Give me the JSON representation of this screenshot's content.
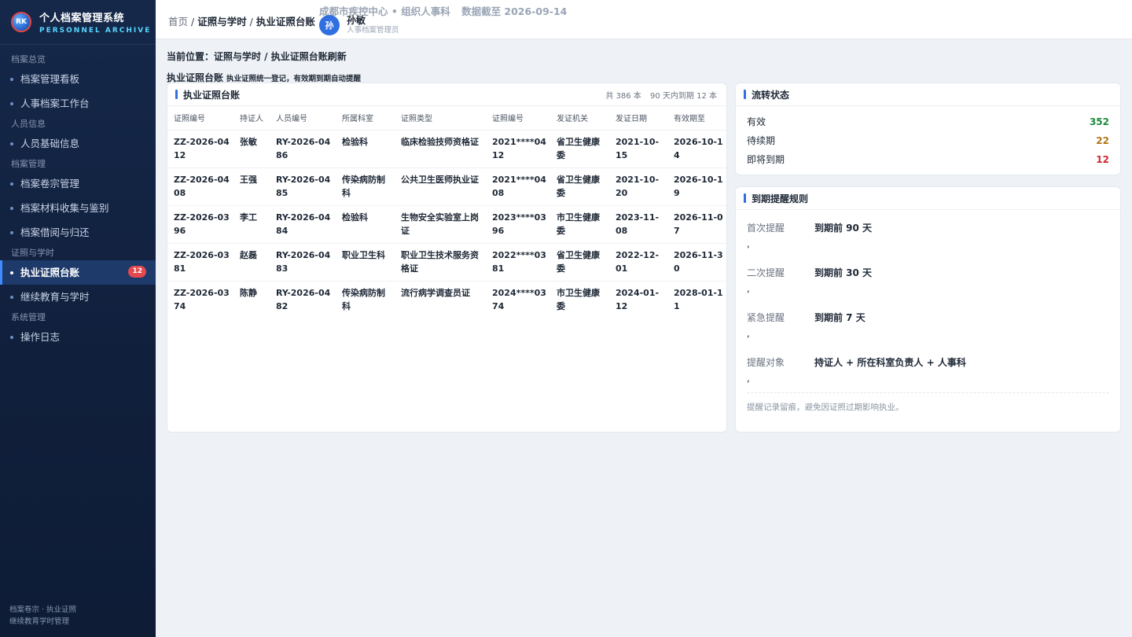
{
  "app": {
    "title": "个人档案管理系统",
    "subtitle": "PERSONNEL ARCHIVE",
    "logo_text": "RK",
    "footer_line1": "档案卷宗 · 执业证照",
    "footer_line2": "继续教育学时管理"
  },
  "sidebar": {
    "groups": [
      {
        "label": "档案总览",
        "items": [
          {
            "label": "档案管理看板"
          },
          {
            "label": "人事档案工作台"
          }
        ]
      },
      {
        "label": "人员信息",
        "items": [
          {
            "label": "人员基础信息"
          }
        ]
      },
      {
        "label": "档案管理",
        "items": [
          {
            "label": "档案卷宗管理"
          },
          {
            "label": "档案材料收集与鉴别"
          },
          {
            "label": "档案借阅与归还"
          }
        ]
      },
      {
        "label": "证照与学时",
        "items": [
          {
            "label": "执业证照台账",
            "badge": "12",
            "active": true
          },
          {
            "label": "继续教育与学时"
          }
        ]
      },
      {
        "label": "系统管理",
        "items": [
          {
            "label": "操作日志"
          }
        ]
      }
    ]
  },
  "topbar": {
    "breadcrumb_home": "首页",
    "breadcrumb_sep1": " / ",
    "breadcrumb_mid": "证照与学时",
    "breadcrumb_sep2": " / ",
    "breadcrumb_current": "执业证照台账",
    "org": "成都市疾控中心 • 组织人事科",
    "data_date": "数据截至 2026-09-14",
    "user_initial": "孙",
    "user_name": "孙敏",
    "user_role": "人事档案管理员"
  },
  "page": {
    "location": "当前位置：证照与学时 / 执业证照台账刷新",
    "title": "执业证照台账",
    "description": "执业证照统一登记，有效期到期自动提醒"
  },
  "ledger": {
    "title": "执业证照台账",
    "total": "共 386 本",
    "expiring": "90 天内到期 12 本",
    "columns": [
      "证照编号",
      "持证人",
      "人员编号",
      "所属科室",
      "证照类型",
      "证照编号",
      "发证机关",
      "发证日期",
      "有效期至"
    ],
    "rows": [
      [
        "ZZ-2026-0412",
        "张敏",
        "RY-2026-0486",
        "检验科",
        "临床检验技师资格证",
        "2021****0412",
        "省卫生健康委",
        "2021-10-15",
        "2026-10-14"
      ],
      [
        "ZZ-2026-0408",
        "王强",
        "RY-2026-0485",
        "传染病防制科",
        "公共卫生医师执业证",
        "2021****0408",
        "省卫生健康委",
        "2021-10-20",
        "2026-10-19"
      ],
      [
        "ZZ-2026-0396",
        "李工",
        "RY-2026-0484",
        "检验科",
        "生物安全实验室上岗证",
        "2023****0396",
        "市卫生健康委",
        "2023-11-08",
        "2026-11-07"
      ],
      [
        "ZZ-2026-0381",
        "赵磊",
        "RY-2026-0483",
        "职业卫生科",
        "职业卫生技术服务资格证",
        "2022****0381",
        "省卫生健康委",
        "2022-12-01",
        "2026-11-30"
      ],
      [
        "ZZ-2026-0374",
        "陈静",
        "RY-2026-0482",
        "传染病防制科",
        "流行病学调查员证",
        "2024****0374",
        "市卫生健康委",
        "2024-01-12",
        "2028-01-11"
      ]
    ]
  },
  "status": {
    "title": "流转状态",
    "items": [
      {
        "label": "有效",
        "value": "352",
        "color": "#1b8a3c"
      },
      {
        "label": "待续期",
        "value": "22",
        "color": "#b27514"
      },
      {
        "label": "即将到期",
        "value": "12",
        "color": "#d0272f"
      }
    ]
  },
  "rules": {
    "title": "到期提醒规则",
    "items": [
      {
        "key": "首次提醒",
        "value": "到期前 90 天",
        "trail": ","
      },
      {
        "key": "二次提醒",
        "value": "到期前 30 天",
        "trail": ","
      },
      {
        "key": "紧急提醒",
        "value": "到期前 7 天",
        "trail": ","
      },
      {
        "key": "提醒对象",
        "value": "持证人 + 所在科室负责人 + 人事科",
        "trail": ","
      }
    ],
    "footnote": "提醒记录留痕，避免因证照过期影响执业。"
  }
}
